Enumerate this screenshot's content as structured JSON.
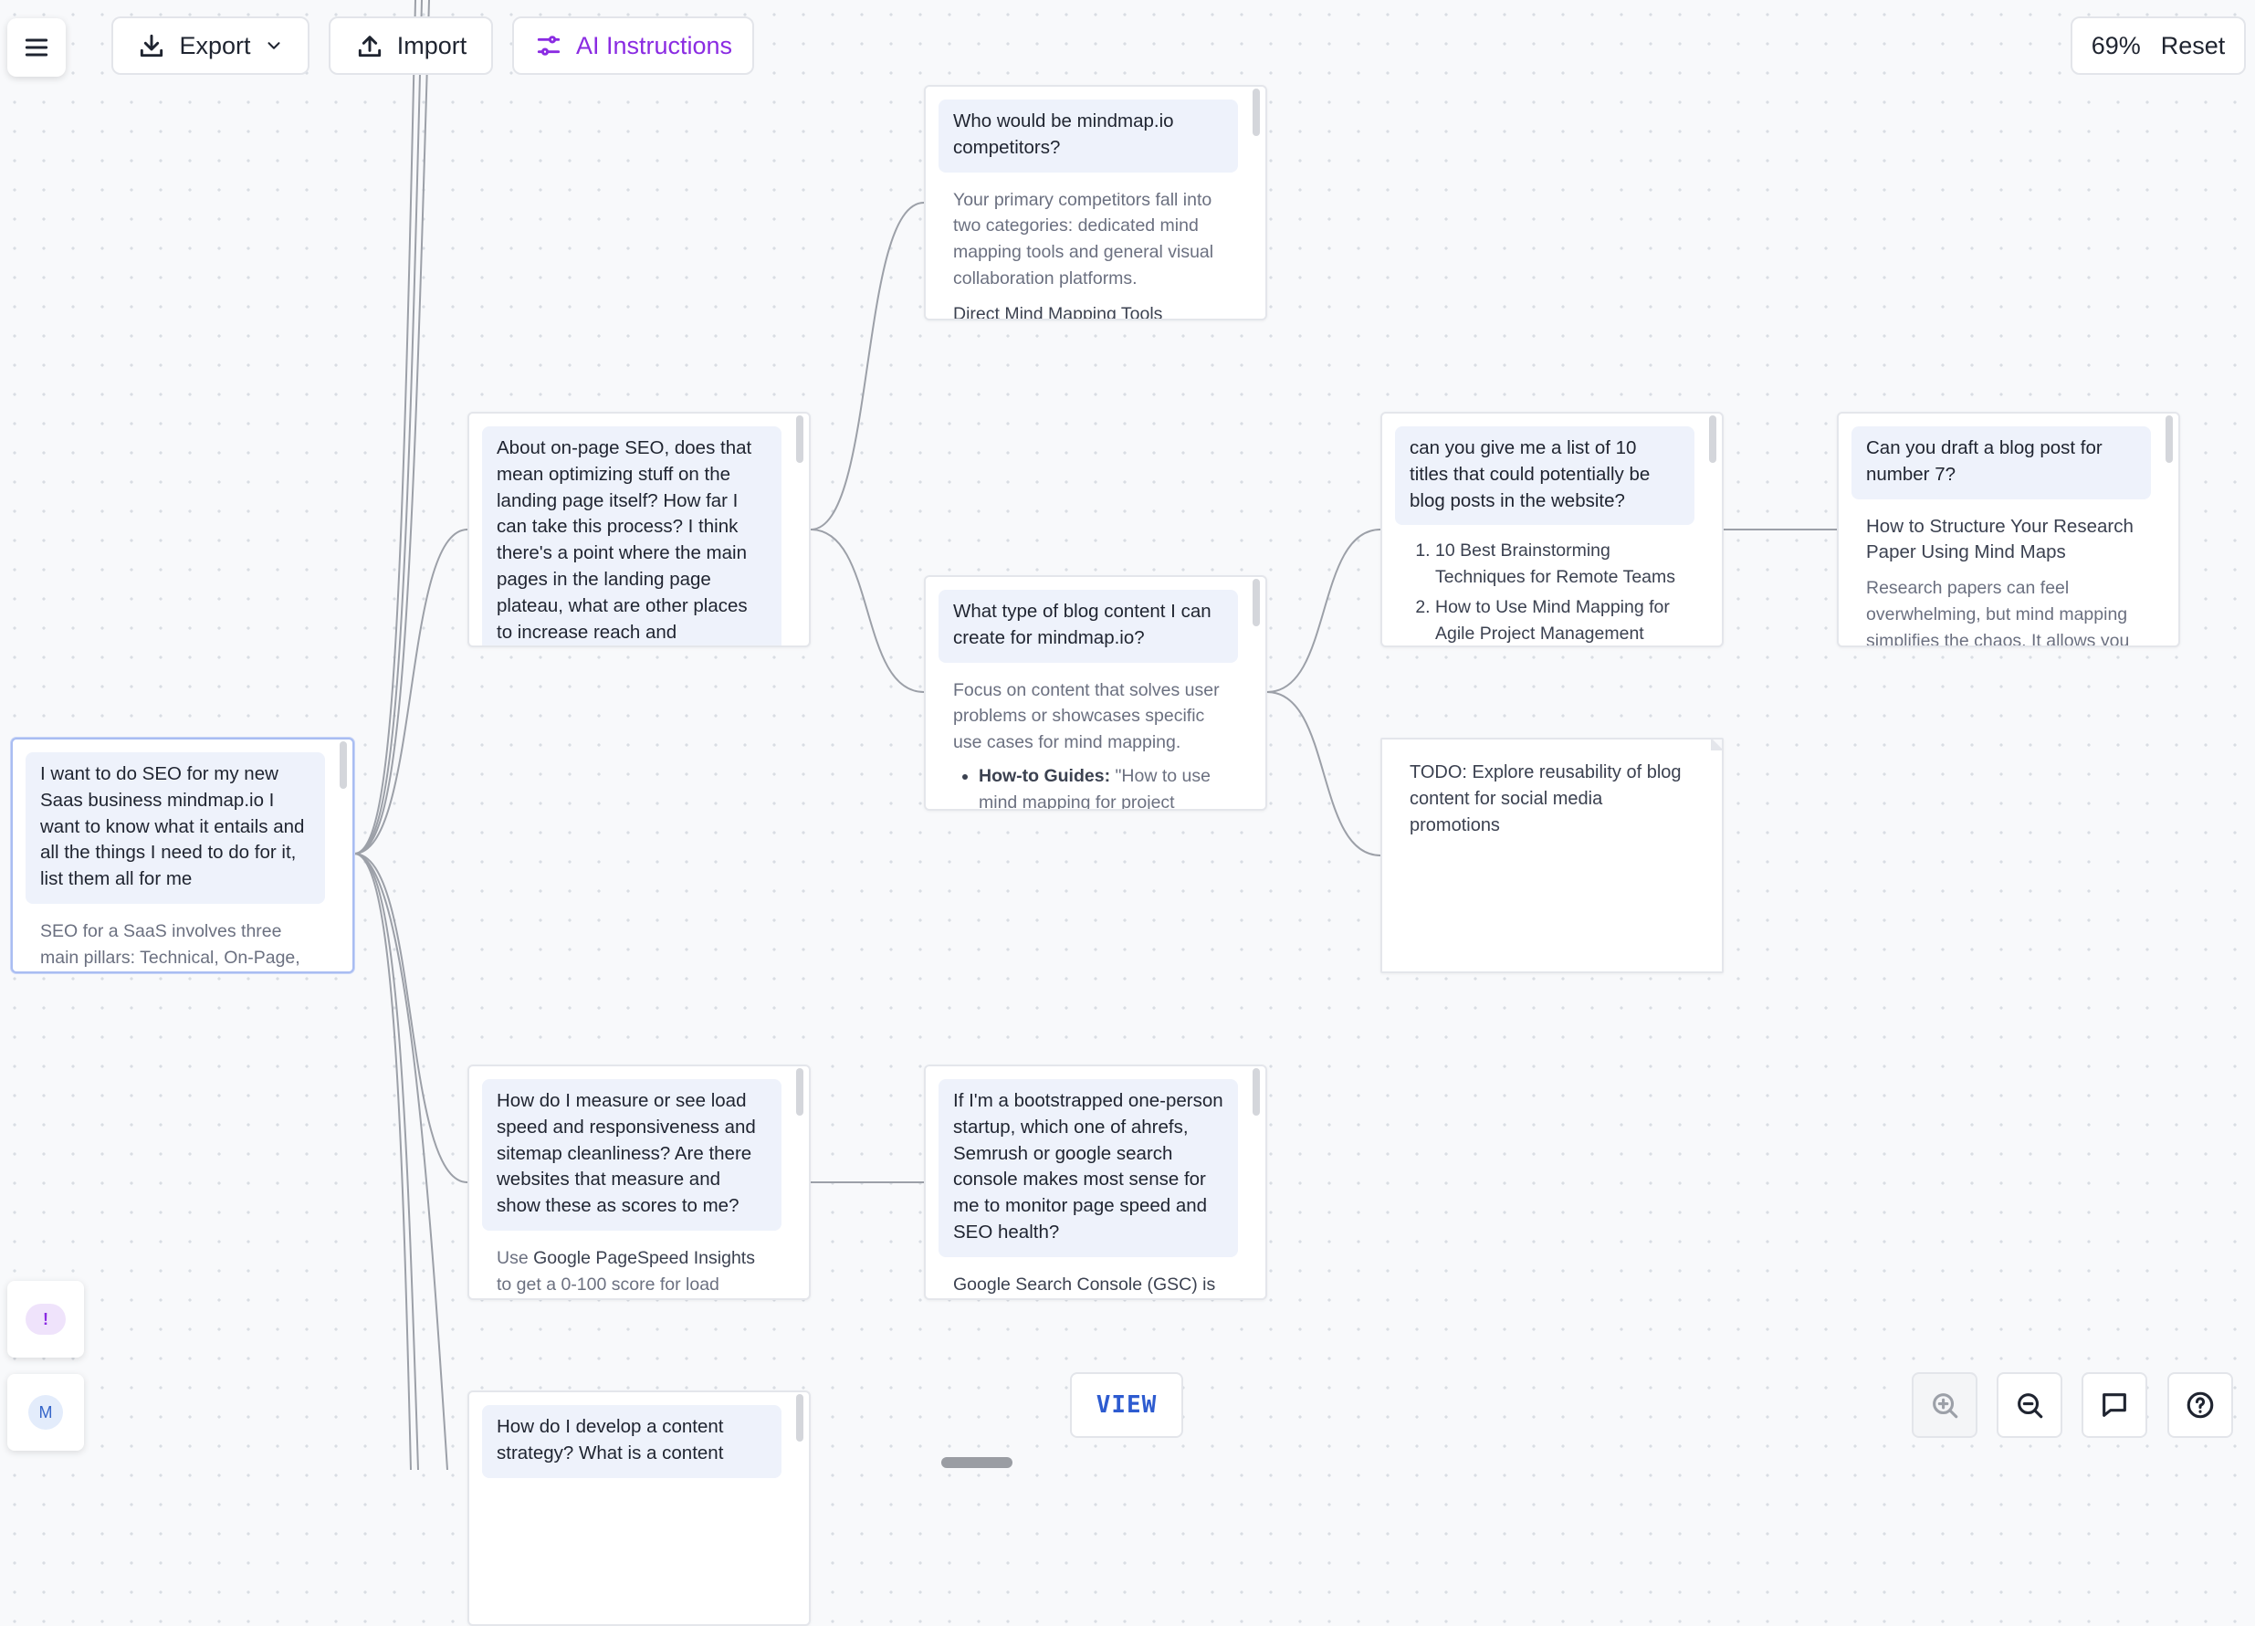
{
  "toolbar": {
    "export_label": "Export",
    "import_label": "Import",
    "ai_label": "AI Instructions",
    "zoom_level": "69%",
    "reset_label": "Reset",
    "accent_color": "#8a2be2"
  },
  "nodes": {
    "root": {
      "question": "I want to do SEO for my new Saas business mindmap.io I want to know what it entails and all the things I need to do for it, list them all for me",
      "answer": "SEO for a SaaS involves three main pillars: Technical, On-Page,"
    },
    "onpage": {
      "question": "About on-page SEO, does that mean optimizing stuff on the landing page itself? How far I can take this process? I think there's a point where the main pages in the landing page plateau, what are other places to increase reach and exposure?"
    },
    "competitors": {
      "question": "Who would be mindmap.io competitors?",
      "answer": "Your primary competitors fall into two categories: dedicated mind mapping tools and general visual collaboration platforms.",
      "subheading": "Direct Mind Mapping Tools"
    },
    "blog_content": {
      "question": "What type of blog content I can create for mindmap.io?",
      "answer": "Focus on content that solves user problems or showcases specific use cases for mind mapping.",
      "bullet_label": "How-to Guides:",
      "bullet_text": " \"How to use mind mapping for project"
    },
    "titles": {
      "question": "can you give me a list of 10 titles that could potentially be blog posts in the website?",
      "items": [
        "10 Best Brainstorming Techniques for Remote Teams",
        "How to Use Mind Mapping for Agile Project Management"
      ]
    },
    "draft": {
      "question": "Can you draft a blog post for number 7?",
      "heading": "How to Structure Your Research Paper Using Mind Maps",
      "answer": "Research papers can feel overwhelming, but mind mapping simplifies the chaos. It allows you"
    },
    "todo": {
      "text": "TODO: Explore reusability of blog content for social media promotions"
    },
    "speed": {
      "question": "How do I measure or see load speed and responsiveness and sitemap cleanliness? Are there websites that measure and show these as scores to me?",
      "answer_prefix": "Use ",
      "answer_bold": "Google PageSpeed Insights",
      "answer_suffix": " to get a 0-100 score for load"
    },
    "tools": {
      "question": "If I'm a bootstrapped one-person startup, which one of ahrefs, Semrush or google search console makes most sense for me to monitor page speed and SEO health?",
      "answer": "Google Search Console (GSC) is"
    },
    "strategy": {
      "question": "How do I develop a content strategy? What is a content"
    }
  },
  "bottom": {
    "alert_badge": "!",
    "avatar_initial": "M",
    "view_label": "VIEW"
  }
}
